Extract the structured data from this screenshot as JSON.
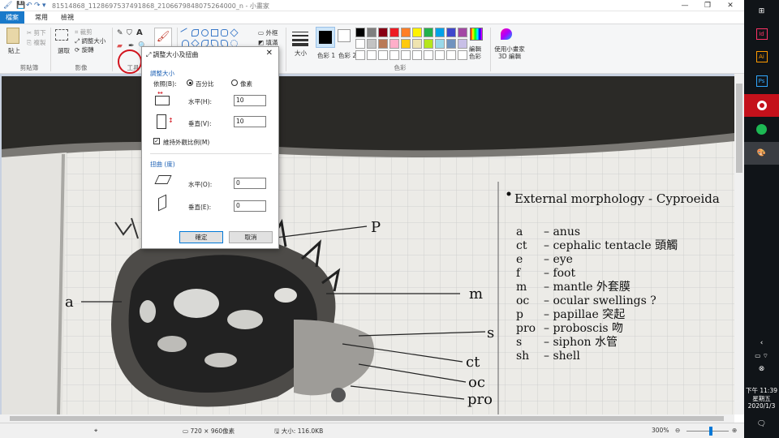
{
  "titlebar": {
    "title": "81514868_1128697537491868_2106679848075264000_n - 小畫家",
    "quick_access": [
      "💾",
      "↶",
      "↷",
      "▾"
    ]
  },
  "tabs": [
    "檔案",
    "常用",
    "檢視"
  ],
  "ribbon": {
    "clipboard": {
      "paste": "貼上",
      "cut": "剪下",
      "copy": "複製",
      "label": "剪貼簿"
    },
    "image": {
      "select": "選取",
      "crop": "裁剪",
      "resize": "調整大小",
      "rotate": "旋轉",
      "label": "影像"
    },
    "tools": {
      "label": "工具"
    },
    "brushes": {
      "label": "筆刷"
    },
    "shapes": {
      "outline": "外框",
      "fill": "填滿",
      "label": "圖形"
    },
    "size": {
      "label": "大小"
    },
    "color1": {
      "label": "色彩 1"
    },
    "color2": {
      "label": "色彩 2"
    },
    "colors_label": "色彩",
    "edit_colors": "編輯色彩",
    "paint3d": "使用小畫家 3D 編輯",
    "palette": [
      "#000000",
      "#7f7f7f",
      "#880015",
      "#ed1c24",
      "#ff7f27",
      "#fff200",
      "#22b14c",
      "#00a2e8",
      "#3f48cc",
      "#a349a4",
      "#ffffff",
      "#c3c3c3",
      "#b97a57",
      "#ffaec9",
      "#ffc90e",
      "#efe4b0",
      "#b5e61d",
      "#99d9ea",
      "#7092be",
      "#c8bfe7"
    ]
  },
  "dialog": {
    "title": "調整大小及扭曲",
    "close": "✕",
    "resize_section": "調整大小",
    "by_label": "依照(B):",
    "percent": "百分比",
    "pixels": "像素",
    "horizontal_label": "水平(H):",
    "horizontal_value": "10",
    "vertical_label": "垂直(V):",
    "vertical_value": "10",
    "maintain_ratio": "維持外觀比例(M)",
    "skew_section": "扭曲 (度)",
    "skew_h_label": "水平(O):",
    "skew_h_value": "0",
    "skew_v_label": "垂直(E):",
    "skew_v_value": "0",
    "ok": "確定",
    "cancel": "取消"
  },
  "notebook": {
    "heading": "External morphology - Cyproeida",
    "legend": [
      {
        "k": "a",
        "v": "anus"
      },
      {
        "k": "ct",
        "v": "cephalic tentacle 頭觸"
      },
      {
        "k": "e",
        "v": "eye"
      },
      {
        "k": "f",
        "v": "foot"
      },
      {
        "k": "m",
        "v": "mantle 外套膜"
      },
      {
        "k": "oc",
        "v": "ocular swellings ?"
      },
      {
        "k": "p",
        "v": "papillae 突起"
      },
      {
        "k": "pro",
        "v": "proboscis 吻"
      },
      {
        "k": "s",
        "v": "siphon 水管"
      },
      {
        "k": "sh",
        "v": "shell"
      }
    ],
    "callouts": [
      "P",
      "a",
      "m",
      "s",
      "ct",
      "oc",
      "pro"
    ]
  },
  "statusbar": {
    "dimensions": "720 × 960像素",
    "size": "大小: 116.0KB",
    "zoom": "300%"
  },
  "taskbar": {
    "time": "下午 11:39",
    "weekday": "星期五",
    "date": "2020/1/3"
  },
  "colors": {
    "accent": "#1979ca",
    "annotation_red": "#d2141e"
  }
}
